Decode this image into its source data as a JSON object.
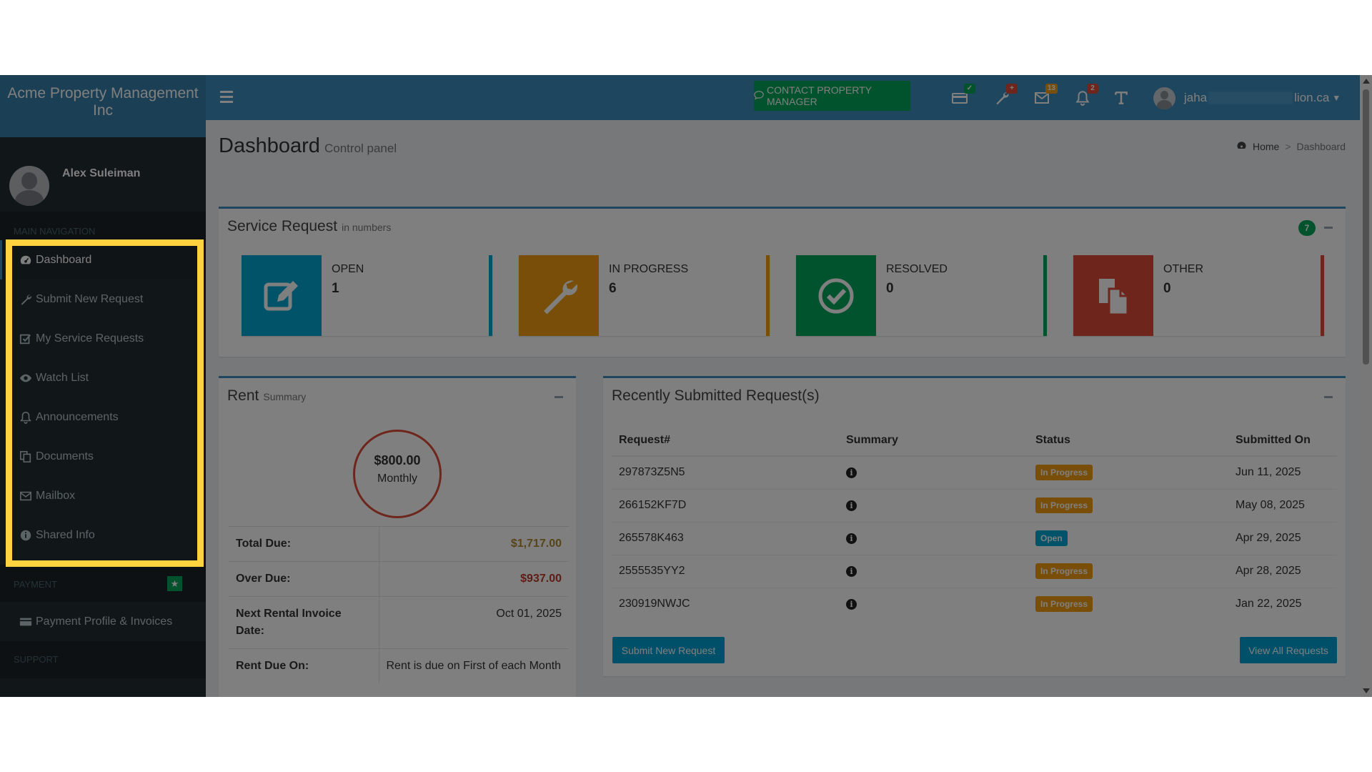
{
  "app": {
    "company": "Acme Property Management Inc",
    "user_name": "Alex Suleiman"
  },
  "sidebar": {
    "main_header": "MAIN NAVIGATION",
    "items": [
      {
        "label": "Dashboard",
        "icon": "dashboard-icon"
      },
      {
        "label": "Submit New Request",
        "icon": "wrench-icon"
      },
      {
        "label": "My Service Requests",
        "icon": "check-square-icon"
      },
      {
        "label": "Watch List",
        "icon": "eye-icon"
      },
      {
        "label": "Announcements",
        "icon": "bell-icon"
      },
      {
        "label": "Documents",
        "icon": "documents-icon"
      },
      {
        "label": "Mailbox",
        "icon": "envelope-icon"
      },
      {
        "label": "Shared Info",
        "icon": "info-circle-icon"
      }
    ],
    "payment_header": "PAYMENT",
    "payment_items": [
      {
        "label": "Payment Profile & Invoices",
        "icon": "credit-card-icon"
      }
    ],
    "support_header": "SUPPORT"
  },
  "topbar": {
    "contact_label": "CONTACT PROPERTY MANAGER",
    "badges": {
      "payment": "✓",
      "requests": "+",
      "mail": "13",
      "notifications": "2"
    },
    "user_email_start": "jaha",
    "user_email_end": "lion.ca"
  },
  "page": {
    "title": "Dashboard",
    "subtitle": "Control panel",
    "breadcrumb_home": "Home",
    "breadcrumb_sep": ">",
    "breadcrumb_current": "Dashboard"
  },
  "service_request": {
    "title": "Service Request",
    "subtitle": "in numbers",
    "total_badge": "7",
    "boxes": [
      {
        "label": "OPEN",
        "count": "1",
        "color": "#00a7d0",
        "icon": "edit-icon"
      },
      {
        "label": "IN PROGRESS",
        "count": "6",
        "color": "#f39c12",
        "icon": "wrench-icon"
      },
      {
        "label": "RESOLVED",
        "count": "0",
        "color": "#00a65a",
        "icon": "check-circle-icon"
      },
      {
        "label": "OTHER",
        "count": "0",
        "color": "#dd4b39",
        "icon": "files-icon"
      }
    ]
  },
  "rent": {
    "title": "Rent",
    "subtitle": "Summary",
    "amount": "$800.00",
    "period": "Monthly",
    "rows": [
      {
        "key": "Total Due:",
        "value": "$1,717.00"
      },
      {
        "key": "Over Due:",
        "value": "$937.00"
      },
      {
        "key": "Next Rental Invoice Date:",
        "value": "Oct 01, 2025"
      },
      {
        "key": "Rent Due On:",
        "value": "Rent is due on First of each Month"
      }
    ]
  },
  "recent": {
    "title": "Recently Submitted Request(s)",
    "columns": [
      "Request#",
      "Summary",
      "Status",
      "Submitted On"
    ],
    "rows": [
      {
        "id": "297873Z5N5",
        "status": "In Progress",
        "date": "Jun 11, 2025"
      },
      {
        "id": "266152KF7D",
        "status": "In Progress",
        "date": "May 08, 2025"
      },
      {
        "id": "265578K463",
        "status": "Open",
        "date": "Apr 29, 2025"
      },
      {
        "id": "2555535YY2",
        "status": "In Progress",
        "date": "Apr 28, 2025"
      },
      {
        "id": "230919NWJC",
        "status": "In Progress",
        "date": "Jan 22, 2025"
      }
    ],
    "info_glyph": "i",
    "submit_label": "Submit New Request",
    "view_all_label": "View All Requests"
  },
  "colors": {
    "primary": "#3c8dbc",
    "success": "#00a65a",
    "warning": "#f39c12",
    "danger": "#dd4b39",
    "info": "#00c0ef",
    "highlight": "#ffd23f"
  }
}
